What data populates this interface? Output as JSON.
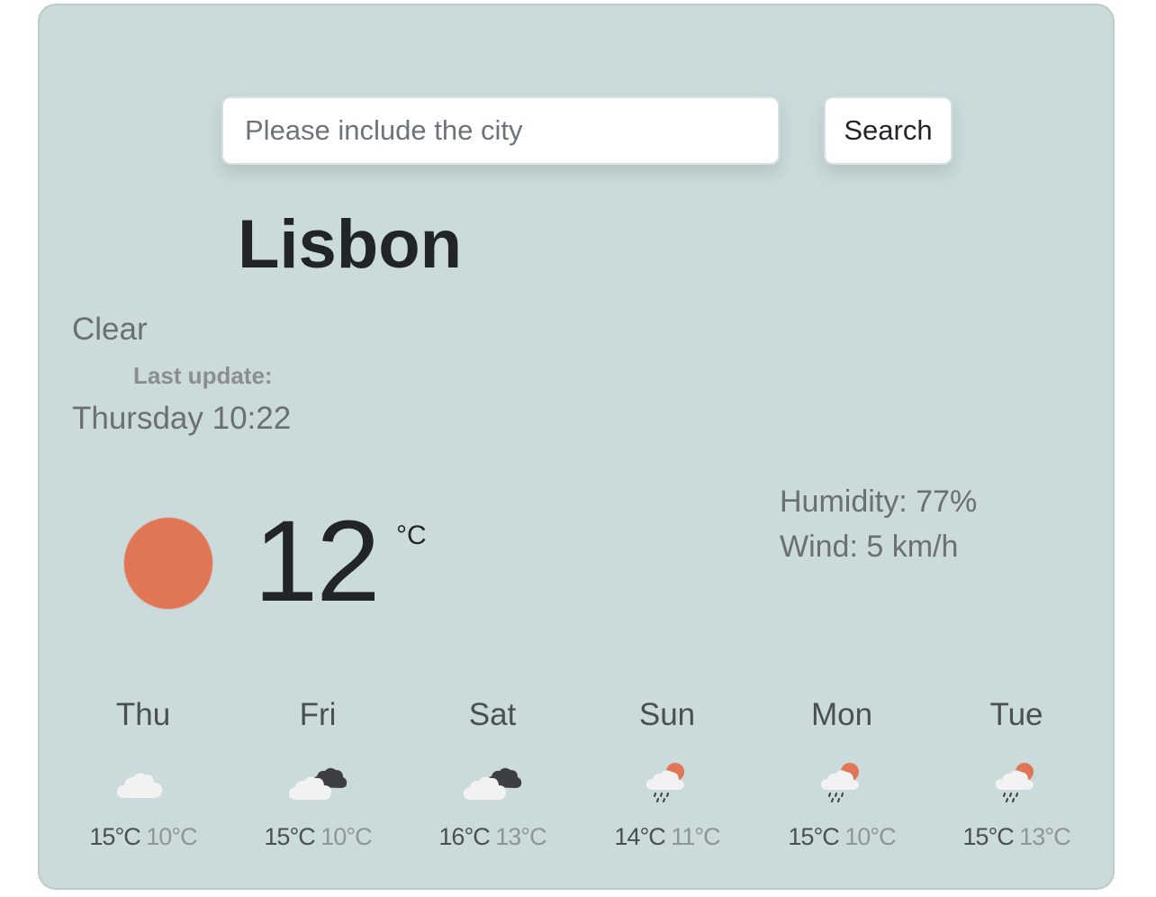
{
  "search": {
    "placeholder": "Please include the city",
    "button_label": "Search"
  },
  "current": {
    "city": "Lisbon",
    "description": "Clear",
    "last_update_label": "Last update:",
    "last_update_value": "Thursday 10:22",
    "icon": "sun-icon",
    "temperature": "12",
    "unit": "°C",
    "humidity": "Humidity: 77%",
    "wind": "Wind: 5 km/h"
  },
  "forecast": [
    {
      "day": "Thu",
      "icon": "cloud-icon",
      "max": "15°C",
      "min": "10°C"
    },
    {
      "day": "Fri",
      "icon": "clouds-icon",
      "max": "15°C",
      "min": "10°C"
    },
    {
      "day": "Sat",
      "icon": "clouds-icon",
      "max": "16°C",
      "min": "13°C"
    },
    {
      "day": "Sun",
      "icon": "rain-sun-icon",
      "max": "14°C",
      "min": "11°C"
    },
    {
      "day": "Mon",
      "icon": "rain-sun-icon",
      "max": "15°C",
      "min": "10°C"
    },
    {
      "day": "Tue",
      "icon": "rain-sun-icon",
      "max": "15°C",
      "min": "13°C"
    }
  ],
  "colors": {
    "card_background": "#cbdbdb",
    "sun": "#e07656",
    "text_dark": "#212529",
    "text_muted": "#6b6f72"
  }
}
